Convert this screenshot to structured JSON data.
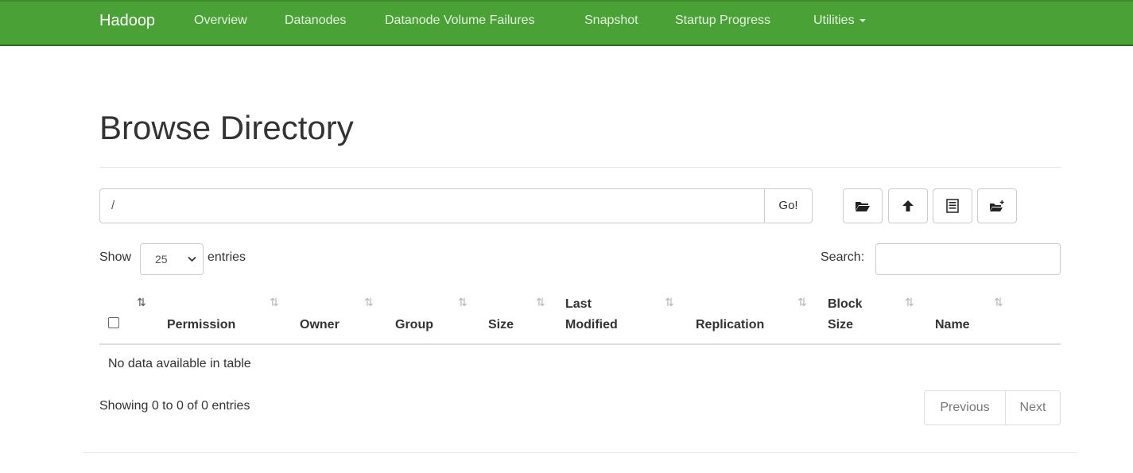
{
  "navbar": {
    "brand": "Hadoop",
    "items": [
      {
        "label": "Overview"
      },
      {
        "label": "Datanodes"
      },
      {
        "label": "Datanode Volume Failures"
      },
      {
        "label": "Snapshot"
      },
      {
        "label": "Startup Progress"
      },
      {
        "label": "Utilities"
      }
    ],
    "background_color": "#4aa236"
  },
  "page": {
    "title": "Browse Directory"
  },
  "path_bar": {
    "value": "/",
    "go_label": "Go!"
  },
  "toolbar": {
    "icons": [
      "folder-open-icon",
      "upload-cloud-icon",
      "list-icon",
      "create-folder-icon"
    ]
  },
  "table_controls": {
    "show_label": "Show",
    "entries_value": "25",
    "entries_label": "entries",
    "search_label": "Search:",
    "search_value": ""
  },
  "table": {
    "columns": [
      {
        "label": "Permission"
      },
      {
        "label": "Owner"
      },
      {
        "label": "Group"
      },
      {
        "label": "Size"
      },
      {
        "label_line1": "Last",
        "label_line2": "Modified"
      },
      {
        "label": "Replication"
      },
      {
        "label_line1": "Block",
        "label_line2": "Size"
      },
      {
        "label": "Name"
      }
    ],
    "empty_message": "No data available in table",
    "info": "Showing 0 to 0 of 0 entries"
  },
  "pagination": {
    "previous": "Previous",
    "next": "Next"
  }
}
